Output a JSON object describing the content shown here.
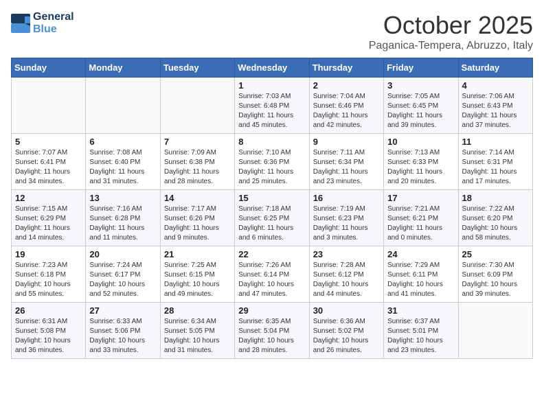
{
  "logo": {
    "line1": "General",
    "line2": "Blue"
  },
  "title": "October 2025",
  "subtitle": "Paganica-Tempera, Abruzzo, Italy",
  "weekdays": [
    "Sunday",
    "Monday",
    "Tuesday",
    "Wednesday",
    "Thursday",
    "Friday",
    "Saturday"
  ],
  "weeks": [
    [
      {
        "day": "",
        "info": ""
      },
      {
        "day": "",
        "info": ""
      },
      {
        "day": "",
        "info": ""
      },
      {
        "day": "1",
        "info": "Sunrise: 7:03 AM\nSunset: 6:48 PM\nDaylight: 11 hours\nand 45 minutes."
      },
      {
        "day": "2",
        "info": "Sunrise: 7:04 AM\nSunset: 6:46 PM\nDaylight: 11 hours\nand 42 minutes."
      },
      {
        "day": "3",
        "info": "Sunrise: 7:05 AM\nSunset: 6:45 PM\nDaylight: 11 hours\nand 39 minutes."
      },
      {
        "day": "4",
        "info": "Sunrise: 7:06 AM\nSunset: 6:43 PM\nDaylight: 11 hours\nand 37 minutes."
      }
    ],
    [
      {
        "day": "5",
        "info": "Sunrise: 7:07 AM\nSunset: 6:41 PM\nDaylight: 11 hours\nand 34 minutes."
      },
      {
        "day": "6",
        "info": "Sunrise: 7:08 AM\nSunset: 6:40 PM\nDaylight: 11 hours\nand 31 minutes."
      },
      {
        "day": "7",
        "info": "Sunrise: 7:09 AM\nSunset: 6:38 PM\nDaylight: 11 hours\nand 28 minutes."
      },
      {
        "day": "8",
        "info": "Sunrise: 7:10 AM\nSunset: 6:36 PM\nDaylight: 11 hours\nand 25 minutes."
      },
      {
        "day": "9",
        "info": "Sunrise: 7:11 AM\nSunset: 6:34 PM\nDaylight: 11 hours\nand 23 minutes."
      },
      {
        "day": "10",
        "info": "Sunrise: 7:13 AM\nSunset: 6:33 PM\nDaylight: 11 hours\nand 20 minutes."
      },
      {
        "day": "11",
        "info": "Sunrise: 7:14 AM\nSunset: 6:31 PM\nDaylight: 11 hours\nand 17 minutes."
      }
    ],
    [
      {
        "day": "12",
        "info": "Sunrise: 7:15 AM\nSunset: 6:29 PM\nDaylight: 11 hours\nand 14 minutes."
      },
      {
        "day": "13",
        "info": "Sunrise: 7:16 AM\nSunset: 6:28 PM\nDaylight: 11 hours\nand 11 minutes."
      },
      {
        "day": "14",
        "info": "Sunrise: 7:17 AM\nSunset: 6:26 PM\nDaylight: 11 hours\nand 9 minutes."
      },
      {
        "day": "15",
        "info": "Sunrise: 7:18 AM\nSunset: 6:25 PM\nDaylight: 11 hours\nand 6 minutes."
      },
      {
        "day": "16",
        "info": "Sunrise: 7:19 AM\nSunset: 6:23 PM\nDaylight: 11 hours\nand 3 minutes."
      },
      {
        "day": "17",
        "info": "Sunrise: 7:21 AM\nSunset: 6:21 PM\nDaylight: 11 hours\nand 0 minutes."
      },
      {
        "day": "18",
        "info": "Sunrise: 7:22 AM\nSunset: 6:20 PM\nDaylight: 10 hours\nand 58 minutes."
      }
    ],
    [
      {
        "day": "19",
        "info": "Sunrise: 7:23 AM\nSunset: 6:18 PM\nDaylight: 10 hours\nand 55 minutes."
      },
      {
        "day": "20",
        "info": "Sunrise: 7:24 AM\nSunset: 6:17 PM\nDaylight: 10 hours\nand 52 minutes."
      },
      {
        "day": "21",
        "info": "Sunrise: 7:25 AM\nSunset: 6:15 PM\nDaylight: 10 hours\nand 49 minutes."
      },
      {
        "day": "22",
        "info": "Sunrise: 7:26 AM\nSunset: 6:14 PM\nDaylight: 10 hours\nand 47 minutes."
      },
      {
        "day": "23",
        "info": "Sunrise: 7:28 AM\nSunset: 6:12 PM\nDaylight: 10 hours\nand 44 minutes."
      },
      {
        "day": "24",
        "info": "Sunrise: 7:29 AM\nSunset: 6:11 PM\nDaylight: 10 hours\nand 41 minutes."
      },
      {
        "day": "25",
        "info": "Sunrise: 7:30 AM\nSunset: 6:09 PM\nDaylight: 10 hours\nand 39 minutes."
      }
    ],
    [
      {
        "day": "26",
        "info": "Sunrise: 6:31 AM\nSunset: 5:08 PM\nDaylight: 10 hours\nand 36 minutes."
      },
      {
        "day": "27",
        "info": "Sunrise: 6:33 AM\nSunset: 5:06 PM\nDaylight: 10 hours\nand 33 minutes."
      },
      {
        "day": "28",
        "info": "Sunrise: 6:34 AM\nSunset: 5:05 PM\nDaylight: 10 hours\nand 31 minutes."
      },
      {
        "day": "29",
        "info": "Sunrise: 6:35 AM\nSunset: 5:04 PM\nDaylight: 10 hours\nand 28 minutes."
      },
      {
        "day": "30",
        "info": "Sunrise: 6:36 AM\nSunset: 5:02 PM\nDaylight: 10 hours\nand 26 minutes."
      },
      {
        "day": "31",
        "info": "Sunrise: 6:37 AM\nSunset: 5:01 PM\nDaylight: 10 hours\nand 23 minutes."
      },
      {
        "day": "",
        "info": ""
      }
    ]
  ]
}
